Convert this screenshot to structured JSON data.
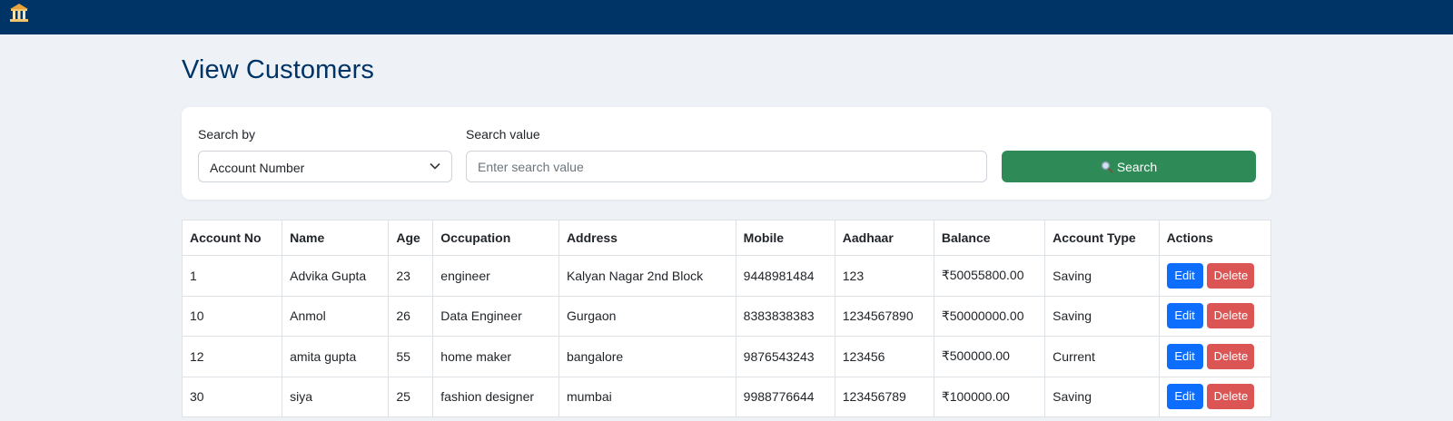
{
  "header": {
    "logo_icon": "bank-building-icon",
    "bg_color": "#003366"
  },
  "page": {
    "title": "View Customers"
  },
  "search": {
    "search_by_label": "Search by",
    "search_by_value": "Account Number",
    "search_value_label": "Search value",
    "search_value_placeholder": "Enter search value",
    "button_label": "Search",
    "button_icon": "magnifier-icon",
    "button_color": "#2e8b57"
  },
  "table": {
    "columns": [
      "Account No",
      "Name",
      "Age",
      "Occupation",
      "Address",
      "Mobile",
      "Aadhaar",
      "Balance",
      "Account Type",
      "Actions"
    ],
    "rows": [
      [
        "1",
        "Advika Gupta",
        "23",
        "engineer",
        "Kalyan Nagar 2nd Block",
        "9448981484",
        "123",
        "₹50055800.00",
        "Saving"
      ],
      [
        "10",
        "Anmol",
        "26",
        "Data Engineer",
        "Gurgaon",
        "8383838383",
        "1234567890",
        "₹50000000.00",
        "Saving"
      ],
      [
        "12",
        "amita gupta",
        "55",
        "home maker",
        "bangalore",
        "9876543243",
        "123456",
        "₹500000.00",
        "Current"
      ],
      [
        "30",
        "siya",
        "25",
        "fashion designer",
        "mumbai",
        "9988776644",
        "123456789",
        "₹100000.00",
        "Saving"
      ]
    ],
    "edit_label": "Edit",
    "delete_label": "Delete"
  }
}
